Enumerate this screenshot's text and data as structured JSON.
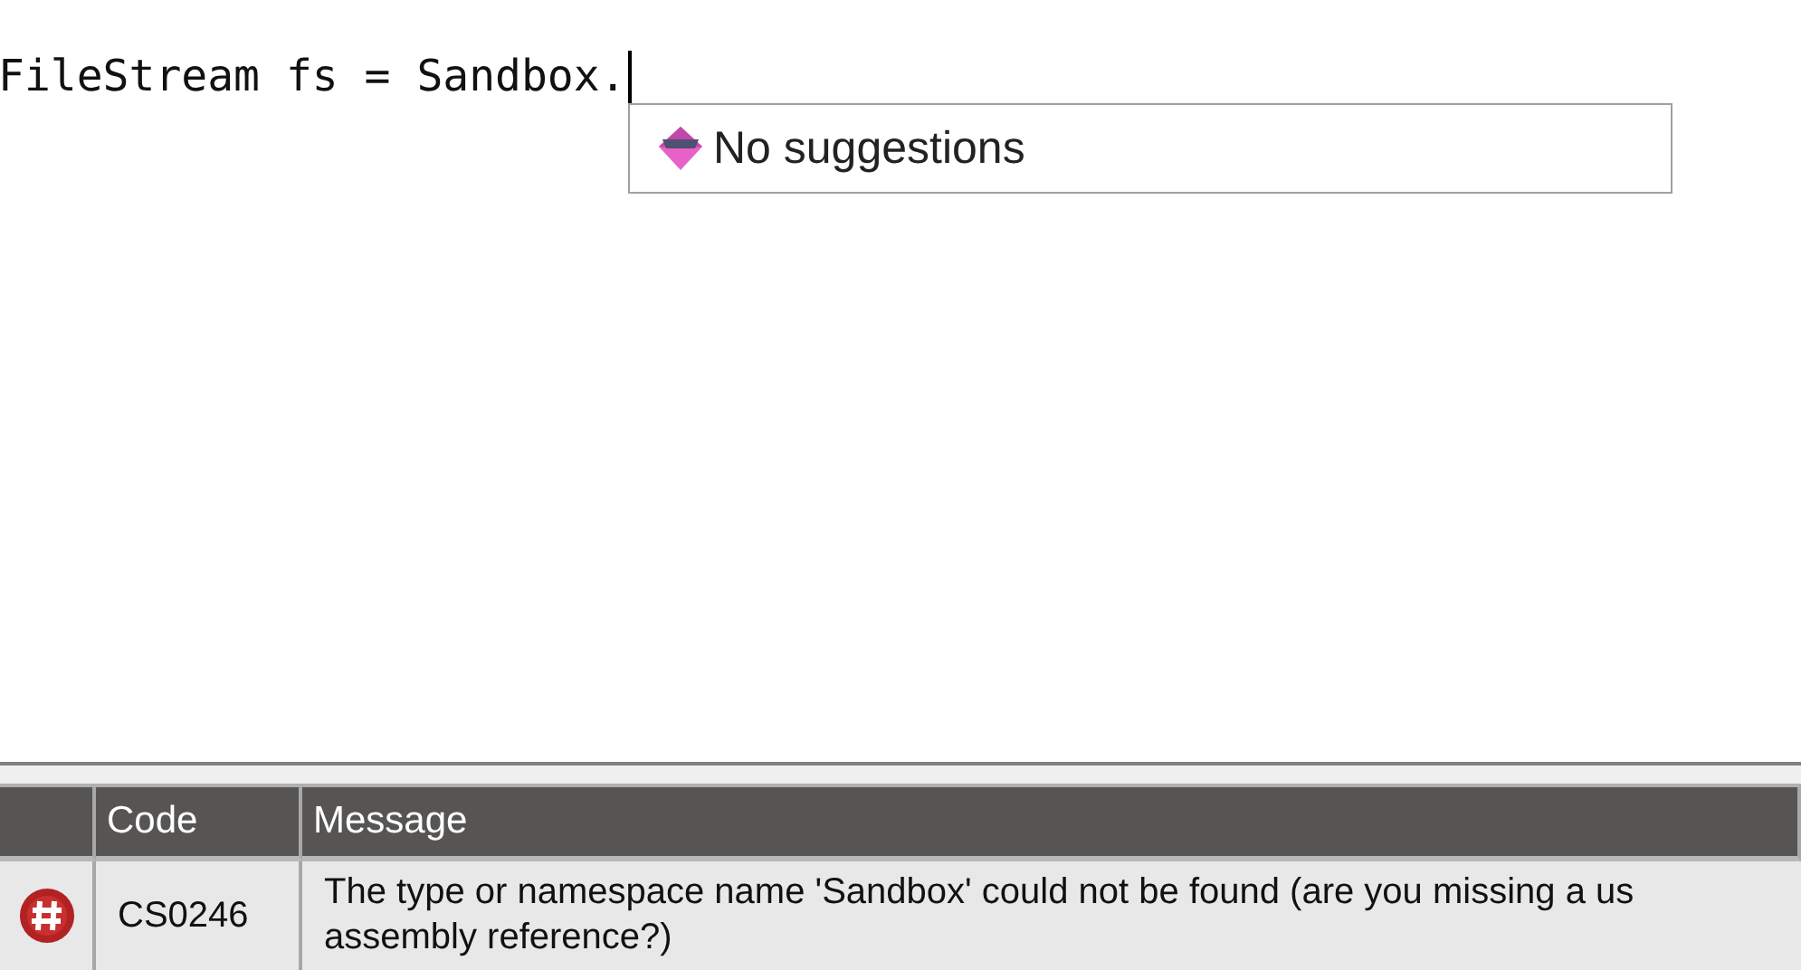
{
  "editor": {
    "code_line": "FileStream fs = Sandbox."
  },
  "completion_popup": {
    "message": "No suggestions"
  },
  "error_list": {
    "columns": [
      {},
      {
        "label": "Code"
      },
      {
        "label": "Message"
      }
    ],
    "rows": [
      {
        "kind": "error",
        "code": "CS0246",
        "message_lines": [
          "The type or namespace name 'Sandbox' could not be found (are you missing a us",
          "assembly reference?)"
        ]
      }
    ]
  }
}
